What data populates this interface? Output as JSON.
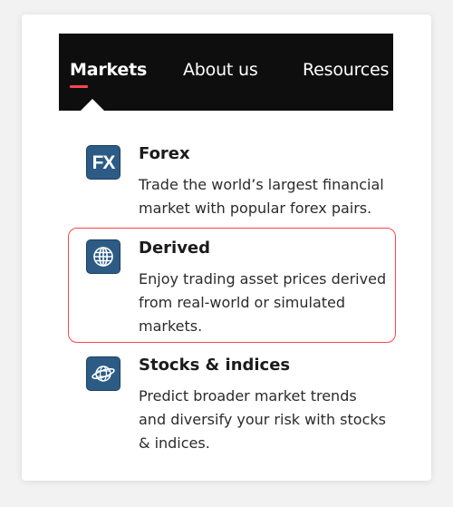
{
  "nav": {
    "items": [
      {
        "label": "Markets",
        "active": true
      },
      {
        "label": "About us",
        "active": false
      },
      {
        "label": "Resources",
        "active": false
      }
    ]
  },
  "markets": [
    {
      "title": "Forex",
      "description": "Trade the world’s largest financial market with popular forex pairs.",
      "icon": "fx-icon",
      "icon_text": "FX"
    },
    {
      "title": "Derived",
      "description": "Enjoy trading asset prices derived from real-world or simulated markets.",
      "icon": "globe-icon",
      "highlighted": true
    },
    {
      "title": "Stocks & indices",
      "description": "Predict broader market trends and diversify your risk with stocks & indices.",
      "icon": "globe-ring-icon"
    }
  ],
  "colors": {
    "accent": "#ff444f",
    "icon_background": "#2c5c85",
    "navbar_background": "#0e0e0e"
  }
}
